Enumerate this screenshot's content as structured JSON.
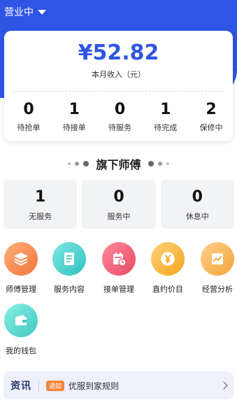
{
  "header": {
    "status_label": "营业中"
  },
  "income": {
    "amount": "¥52.82",
    "label": "本月收入（元）",
    "stats": [
      {
        "num": "0",
        "label": "待抢单"
      },
      {
        "num": "1",
        "label": "待接单"
      },
      {
        "num": "0",
        "label": "待服务"
      },
      {
        "num": "1",
        "label": "待完成"
      },
      {
        "num": "2",
        "label": "保修中"
      }
    ]
  },
  "masters": {
    "title": "旗下师傅",
    "items": [
      {
        "num": "1",
        "label": "无服务"
      },
      {
        "num": "0",
        "label": "服务中"
      },
      {
        "num": "0",
        "label": "休息中"
      }
    ]
  },
  "grid": {
    "items": [
      {
        "label": "师傅管理",
        "icon": "layers-icon"
      },
      {
        "label": "服务内容",
        "icon": "document-icon"
      },
      {
        "label": "接单管理",
        "icon": "calendar-clock-icon"
      },
      {
        "label": "直约价目",
        "icon": "yen-coin-icon"
      },
      {
        "label": "经营分析",
        "icon": "line-chart-icon"
      },
      {
        "label": "我的钱包",
        "icon": "wallet-icon"
      }
    ]
  },
  "news": {
    "brand": "资讯",
    "tag": "通知",
    "text": "优服到家规则"
  },
  "colors": {
    "primary": "#2f55e4",
    "tag": "#f2863a"
  }
}
